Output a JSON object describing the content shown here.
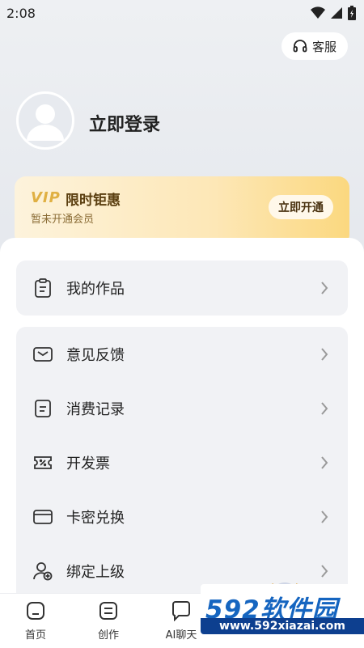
{
  "status_bar": {
    "time": "2:08"
  },
  "header": {
    "customer_service_label": "客服"
  },
  "profile": {
    "login_label": "立即登录"
  },
  "vip_banner": {
    "logo": "VIP",
    "title": "限时钜惠",
    "subtitle": "暂未开通会员",
    "button_label": "立即开通"
  },
  "menu": {
    "group1": [
      {
        "label": "我的作品",
        "icon": "clipboard-icon"
      }
    ],
    "group2": [
      {
        "label": "意见反馈",
        "icon": "mail-icon"
      },
      {
        "label": "消费记录",
        "icon": "receipt-icon"
      },
      {
        "label": "开发票",
        "icon": "ticket-icon"
      },
      {
        "label": "卡密兑换",
        "icon": "card-icon"
      },
      {
        "label": "绑定上级",
        "icon": "user-add-icon"
      }
    ]
  },
  "tab_bar": {
    "tabs": [
      {
        "label": "首页",
        "icon": "home-icon"
      },
      {
        "label": "创作",
        "icon": "create-icon"
      },
      {
        "label": "AI聊天",
        "icon": "chat-icon"
      }
    ]
  },
  "watermark": {
    "brand": "592软件园",
    "url": "www.592xiazai.com"
  },
  "colors": {
    "accent": "#3a7bff",
    "vip_gold": "#e0b043",
    "card_bg": "#f1f2f5"
  }
}
